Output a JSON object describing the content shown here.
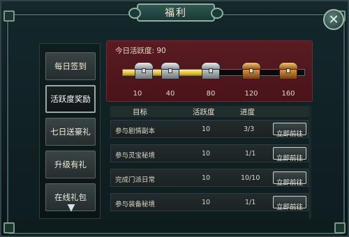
{
  "title": "福利",
  "close_icon": "close-x",
  "menu": {
    "items": [
      {
        "label": "每日签到",
        "active": false
      },
      {
        "label": "活跃度奖励",
        "active": true
      },
      {
        "label": "七日送豪礼",
        "active": false
      },
      {
        "label": "升级有礼",
        "active": false
      },
      {
        "label": "在线礼包",
        "active": false
      }
    ],
    "scroll_icon": "chevron-down-icon"
  },
  "activity": {
    "label": "今日活跃度: 90",
    "progress_fraction": 0.5,
    "milestones": [
      {
        "value": "10",
        "chest": "silver"
      },
      {
        "value": "40",
        "chest": "silver"
      },
      {
        "value": "80",
        "chest": "silver"
      },
      {
        "value": "120",
        "chest": "gold"
      },
      {
        "value": "160",
        "chest": "gold"
      }
    ]
  },
  "table": {
    "headers": {
      "goal": "目标",
      "points": "活跃度",
      "progress": "进度"
    },
    "rows": [
      {
        "goal": "参与剧情副本",
        "points": "10",
        "progress": "3/3",
        "button": "立即前往"
      },
      {
        "goal": "参与灵宝秘境",
        "points": "10",
        "progress": "1/1",
        "button": "立即前往"
      },
      {
        "goal": "完成门派日常",
        "points": "10",
        "progress": "10/10",
        "button": "立即前往"
      },
      {
        "goal": "参与装备秘境",
        "points": "10",
        "progress": "1/1",
        "button": "立即前往"
      }
    ]
  }
}
